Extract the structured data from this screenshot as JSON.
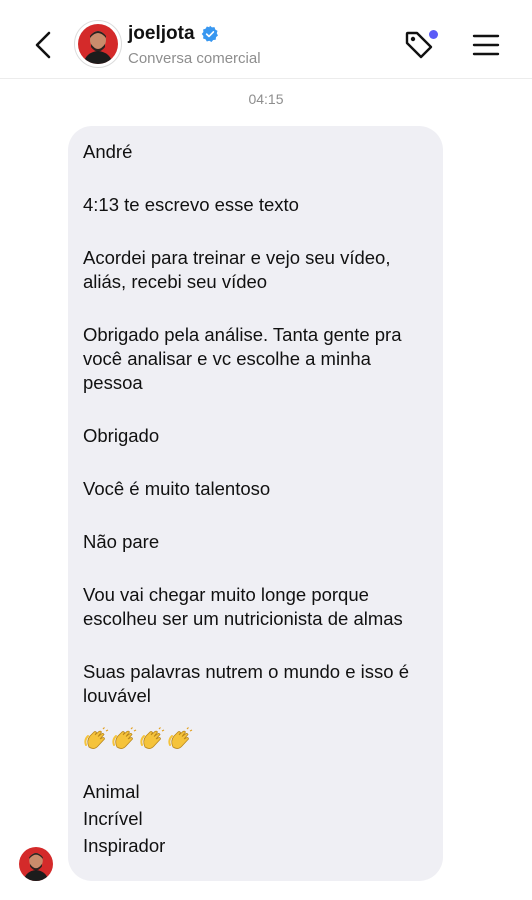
{
  "header": {
    "username": "joeljota",
    "subtitle": "Conversa comercial",
    "verified": true,
    "notification_dot_color": "#5b5bf7",
    "icons": [
      "back-chevron-icon",
      "avatar",
      "verified-badge-icon",
      "tag-icon",
      "menu-icon"
    ]
  },
  "conversation": {
    "timestamp": "04:15",
    "message": {
      "paragraphs": [
        [
          "André"
        ],
        [
          "4:13 te escrevo esse texto"
        ],
        [
          "Acordei para treinar e vejo seu vídeo,",
          "aliás, recebi seu vídeo"
        ],
        [
          "Obrigado pela análise. Tanta gente pra",
          "você analisar e vc escolhe a minha",
          "pessoa"
        ],
        [
          "Obrigado"
        ],
        [
          "Você é muito talentoso"
        ],
        [
          "Não pare"
        ],
        [
          "Vou vai chegar muito longe porque",
          "escolheu ser um nutricionista de almas"
        ],
        [
          "Suas palavras nutrem o mundo e isso é",
          "louvável"
        ]
      ],
      "emoji": "clapping-hands-icon ×4",
      "closing_lines": [
        "Animal",
        "Incrível",
        "Inspirador"
      ]
    }
  },
  "colors": {
    "bubble_background": "#efeff4",
    "verified_blue": "#3897f0",
    "muted_text": "#8e8e8e",
    "avatar_red": "#d42a2a"
  }
}
